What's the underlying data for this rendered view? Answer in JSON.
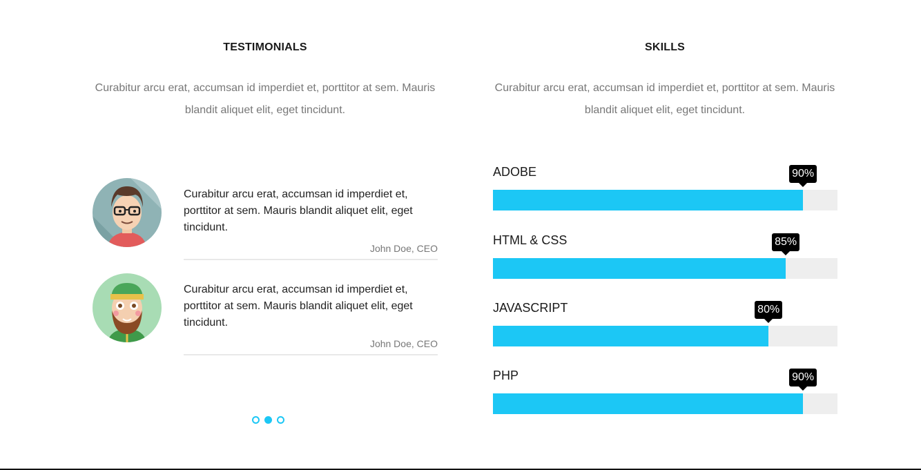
{
  "testimonials": {
    "title": "TESTIMONIALS",
    "description": "Curabitur arcu erat, accumsan id imperdiet et, porttitor at sem. Mauris blandit aliquet elit, eget tincidunt.",
    "items": [
      {
        "quote": "Curabitur arcu erat, accumsan id imperdiet et, porttitor at sem. Mauris blandit aliquet elit, eget tincidunt.",
        "author": "John Doe, CEO",
        "avatar_icon": "man-with-glasses-avatar-icon"
      },
      {
        "quote": "Curabitur arcu erat, accumsan id imperdiet et, porttitor at sem. Mauris blandit aliquet elit, eget tincidunt.",
        "author": "John Doe, CEO",
        "avatar_icon": "bearded-man-with-cap-avatar-icon"
      }
    ],
    "pagination": {
      "count": 3,
      "active_index": 1
    }
  },
  "skills": {
    "title": "SKILLS",
    "description": "Curabitur arcu erat, accumsan id imperdiet et, porttitor at sem. Mauris blandit aliquet elit, eget tincidunt.",
    "items": [
      {
        "label": "ADOBE",
        "percent": 90,
        "percent_text": "90%"
      },
      {
        "label": "HTML & CSS",
        "percent": 85,
        "percent_text": "85%"
      },
      {
        "label": "JAVASCRIPT",
        "percent": 80,
        "percent_text": "80%"
      },
      {
        "label": "PHP",
        "percent": 90,
        "percent_text": "90%"
      }
    ]
  },
  "colors": {
    "accent": "#1cc7f5",
    "track": "#eeeeee",
    "badge": "#000000",
    "muted_text": "#777777"
  }
}
